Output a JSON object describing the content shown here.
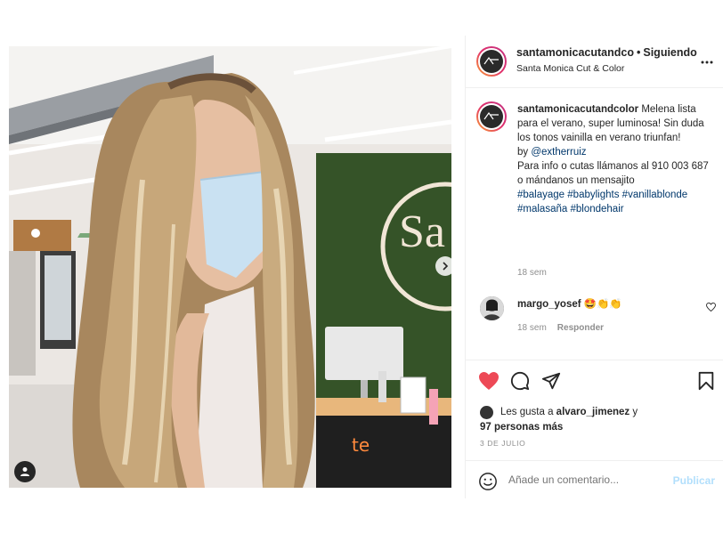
{
  "post": {
    "account": "santamonicacutandco",
    "separator": "•",
    "follow_status": "Siguiendo",
    "location": "Santa Monica Cut & Color",
    "more_icon": "more-horizontal-icon",
    "caption": {
      "username": "santamonicacutandcolor",
      "text_1": "Melena lista para el verano, super luminosa! Sin duda los tonos vainilla en verano triunfan!",
      "by": "by",
      "mention": "@extherruiz",
      "text_2": "Para info o cutas llámanos al 910 003 687 o mándanos un mensajito",
      "hashtags": [
        "#balayage",
        "#babylights",
        "#vanillablonde",
        "#malasaña",
        "#blondehair"
      ],
      "time": "18 sem"
    },
    "comments": [
      {
        "username": "margo_yosef",
        "text": "🤩👏👏",
        "time": "18 sem",
        "reply_label": "Responder"
      }
    ],
    "likes": {
      "prefix": "Les gusta a",
      "user": "alvaro_jimenez",
      "and": "y",
      "others": "97 personas más"
    },
    "date": "3 DE JULIO",
    "add_comment": {
      "placeholder": "Añade un comentario...",
      "post_label": "Publicar"
    }
  },
  "colors": {
    "like_red": "#ed4956",
    "link_blue": "#00376b",
    "publish_disabled": "#b2dffc",
    "story_ring": [
      "#f9a033",
      "#e1306c",
      "#c13584"
    ]
  }
}
